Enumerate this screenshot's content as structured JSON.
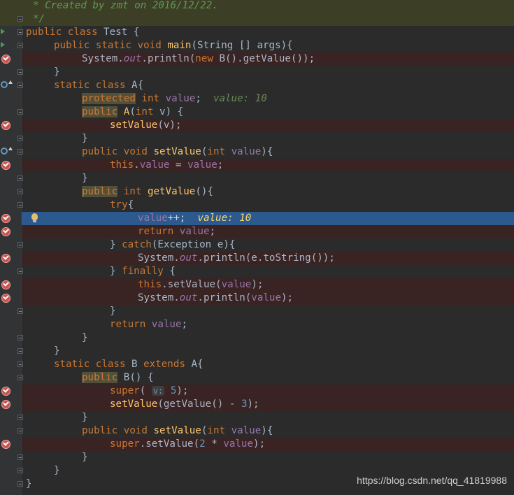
{
  "colors": {
    "background": "#2b2b2b",
    "gutter": "#313335",
    "breakpoint_line": "#3a2323",
    "execution_line": "#2d5a8e",
    "comment_bg": "#3c3f26"
  },
  "lines": [
    {
      "text": "  * Created by zmt on 2016/12/22.",
      "kind": "comment",
      "indent": 0,
      "marker": "none"
    },
    {
      "text": "  */",
      "kind": "comment",
      "indent": 0,
      "marker": "none"
    },
    {
      "text": "public class Test {",
      "kind": "code",
      "indent": 0,
      "marker": "run"
    },
    {
      "text": "public static void main(String [] args){",
      "kind": "code",
      "indent": 1,
      "marker": "run"
    },
    {
      "text": "System.out.println(new B().getValue());",
      "kind": "code",
      "indent": 2,
      "marker": "breakpoint"
    },
    {
      "text": "}",
      "kind": "code",
      "indent": 1,
      "marker": "none"
    },
    {
      "text": "static class A{",
      "kind": "code",
      "indent": 1,
      "marker": "override"
    },
    {
      "text": "protected int value;",
      "hint": "value: 10",
      "kind": "code",
      "indent": 2,
      "marker": "none"
    },
    {
      "text": "public A(int v) {",
      "kind": "code",
      "indent": 2,
      "marker": "none"
    },
    {
      "text": "setValue(v);",
      "kind": "code",
      "indent": 3,
      "marker": "breakpoint"
    },
    {
      "text": "}",
      "kind": "code",
      "indent": 2,
      "marker": "none"
    },
    {
      "text": "public void setValue(int value){",
      "kind": "code",
      "indent": 2,
      "marker": "override"
    },
    {
      "text": "this.value = value;",
      "kind": "code",
      "indent": 3,
      "marker": "breakpoint"
    },
    {
      "text": "}",
      "kind": "code",
      "indent": 2,
      "marker": "none"
    },
    {
      "text": "public int getValue(){",
      "kind": "code",
      "indent": 2,
      "marker": "none"
    },
    {
      "text": "try{",
      "kind": "code",
      "indent": 3,
      "marker": "none"
    },
    {
      "text": "value++;",
      "hint": "value: 10",
      "kind": "code",
      "indent": 4,
      "marker": "breakpoint-current"
    },
    {
      "text": "return value;",
      "kind": "code",
      "indent": 4,
      "marker": "breakpoint"
    },
    {
      "text": "} catch(Exception e){",
      "kind": "code",
      "indent": 3,
      "marker": "none"
    },
    {
      "text": "System.out.println(e.toString());",
      "kind": "code",
      "indent": 4,
      "marker": "breakpoint"
    },
    {
      "text": "} finally {",
      "kind": "code",
      "indent": 3,
      "marker": "none"
    },
    {
      "text": "this.setValue(value);",
      "kind": "code",
      "indent": 4,
      "marker": "breakpoint"
    },
    {
      "text": "System.out.println(value);",
      "kind": "code",
      "indent": 4,
      "marker": "breakpoint"
    },
    {
      "text": "}",
      "kind": "code",
      "indent": 3,
      "marker": "none"
    },
    {
      "text": "return value;",
      "kind": "code",
      "indent": 3,
      "marker": "none"
    },
    {
      "text": "}",
      "kind": "code",
      "indent": 2,
      "marker": "none"
    },
    {
      "text": "}",
      "kind": "code",
      "indent": 1,
      "marker": "none"
    },
    {
      "text": "static class B extends A{",
      "kind": "code",
      "indent": 1,
      "marker": "none"
    },
    {
      "text": "public B() {",
      "kind": "code",
      "indent": 2,
      "marker": "none"
    },
    {
      "text": "super( v: 5);",
      "kind": "code",
      "indent": 3,
      "marker": "breakpoint"
    },
    {
      "text": "setValue(getValue() - 3);",
      "kind": "code",
      "indent": 3,
      "marker": "breakpoint"
    },
    {
      "text": "}",
      "kind": "code",
      "indent": 2,
      "marker": "none"
    },
    {
      "text": "public void setValue(int value){",
      "kind": "code",
      "indent": 2,
      "marker": "none"
    },
    {
      "text": "super.setValue(2 * value);",
      "kind": "code",
      "indent": 3,
      "marker": "breakpoint"
    },
    {
      "text": "}",
      "kind": "code",
      "indent": 2,
      "marker": "none"
    },
    {
      "text": "}",
      "kind": "code",
      "indent": 1,
      "marker": "none"
    },
    {
      "text": "}",
      "kind": "code",
      "indent": 0,
      "marker": "none"
    }
  ],
  "watermark": "https://blog.csdn.net/qq_41819988"
}
